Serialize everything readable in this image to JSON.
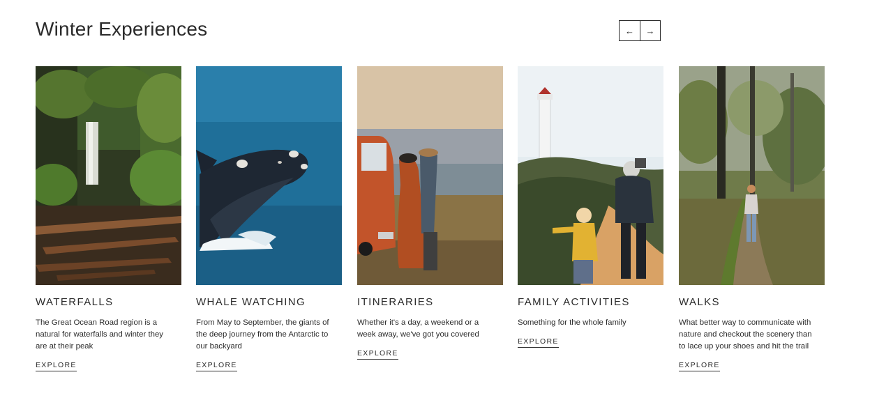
{
  "section": {
    "title": "Winter Experiences",
    "prev_label": "←",
    "next_label": "→"
  },
  "cards": [
    {
      "title": "WATERFALLS",
      "description": "The Great Ocean Road region is a natural for waterfalls and winter they are at their peak",
      "link": "EXPLORE",
      "image": "rainforest-waterfall-photo"
    },
    {
      "title": "WHALE WATCHING",
      "description": "From May to September, the giants of the deep journey from the Antarctic to our backyard",
      "link": "EXPLORE",
      "image": "breaching-whale-photo"
    },
    {
      "title": "ITINERARIES",
      "description": "Whether it's a day, a weekend or a week away, we've got you covered",
      "link": "EXPLORE",
      "image": "couple-with-orange-van-photo"
    },
    {
      "title": "FAMILY ACTIVITIES",
      "description": "Something for the whole family",
      "link": "EXPLORE",
      "image": "family-walking-to-lighthouse-photo"
    },
    {
      "title": "WALKS",
      "description": "What better way to communicate with nature and checkout the scenery than to lace up your shoes and hit the trail",
      "link": "EXPLORE",
      "image": "woman-on-forest-trail-photo"
    }
  ]
}
